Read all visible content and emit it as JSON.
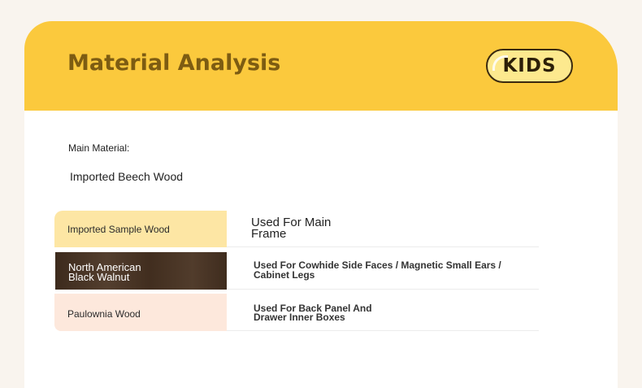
{
  "header": {
    "title": "Material Analysis",
    "badge": "KIDS"
  },
  "main_material": {
    "label": "Main Material:",
    "value": "Imported Beech Wood"
  },
  "rows": [
    {
      "label": "Imported Sample Wood",
      "description_line1": "Used For Main",
      "description_line2": "Frame",
      "swatch_color": "#fde6a4"
    },
    {
      "label_line1": "North American",
      "label_line2": "Black Walnut",
      "description_line1": "Used For Cowhide Side Faces / Magnetic Small Ears /",
      "description_line2": "Cabinet Legs",
      "swatch_color": "#4a3423"
    },
    {
      "label": "Paulownia Wood",
      "description_line1": "Used For Back Panel And",
      "description_line2": "Drawer Inner Boxes",
      "swatch_color": "#fde8dc"
    }
  ],
  "colors": {
    "header_background": "#fbc93d",
    "title_text": "#7d5c12",
    "page_background": "#f9f4ee",
    "card_background": "#ffffff"
  }
}
